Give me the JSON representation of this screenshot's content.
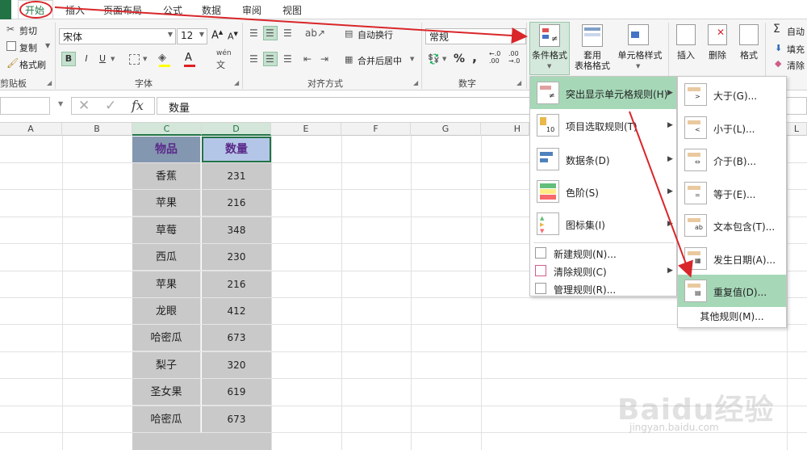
{
  "tabs": [
    "开始",
    "插入",
    "页面布局",
    "公式",
    "数据",
    "审阅",
    "视图"
  ],
  "clipboard": {
    "cut": "剪切",
    "copy": "复制",
    "format_painter": "格式刷",
    "group": "剪贴板"
  },
  "font": {
    "name": "宋体",
    "size": "12",
    "group": "字体",
    "phonetic": "wén"
  },
  "alignment": {
    "wrap_text": "自动换行",
    "merge_center": "合并后居中",
    "group": "对齐方式"
  },
  "number": {
    "format": "常规",
    "percent": "%",
    "comma": ",",
    "inc": "←.0\n.00",
    "dec": ".00\n→.0",
    "group": "数字"
  },
  "styles": {
    "conditional": "条件格式",
    "table_format": "套用\n表格格式",
    "cell_styles": "单元格样式"
  },
  "cells": {
    "insert": "插入",
    "delete": "删除",
    "format": "格式"
  },
  "editing": {
    "autosum": "自动",
    "fill": "填充",
    "clear": "清除"
  },
  "formula_bar": {
    "content": "数量",
    "fx": "fx"
  },
  "columns": [
    "A",
    "B",
    "C",
    "D",
    "E",
    "F",
    "G",
    "H",
    "L"
  ],
  "table": {
    "headers": [
      "物品",
      "数量"
    ],
    "rows": [
      [
        "香蕉",
        "231"
      ],
      [
        "苹果",
        "216"
      ],
      [
        "草莓",
        "348"
      ],
      [
        "西瓜",
        "230"
      ],
      [
        "苹果",
        "216"
      ],
      [
        "龙眼",
        "412"
      ],
      [
        "哈密瓜",
        "673"
      ],
      [
        "梨子",
        "320"
      ],
      [
        "圣女果",
        "619"
      ],
      [
        "哈密瓜",
        "673"
      ]
    ]
  },
  "menu1": {
    "items": [
      "突出显示单元格规则(H)",
      "项目选取规则(T)",
      "数据条(D)",
      "色阶(S)",
      "图标集(I)"
    ],
    "small_items": [
      "新建规则(N)...",
      "清除规则(C)",
      "管理规则(R)..."
    ]
  },
  "menu2": {
    "items": [
      "大于(G)...",
      "小于(L)...",
      "介于(B)...",
      "等于(E)...",
      "文本包含(T)...",
      "发生日期(A)...",
      "重复值(D)..."
    ],
    "more": "其他规则(M)..."
  },
  "watermark": {
    "brand": "Baidu经验",
    "url": "jingyan.baidu.com"
  },
  "colors": {
    "accent": "#217346",
    "arrow": "#d9262a",
    "highlight": "#a6d8b8"
  }
}
